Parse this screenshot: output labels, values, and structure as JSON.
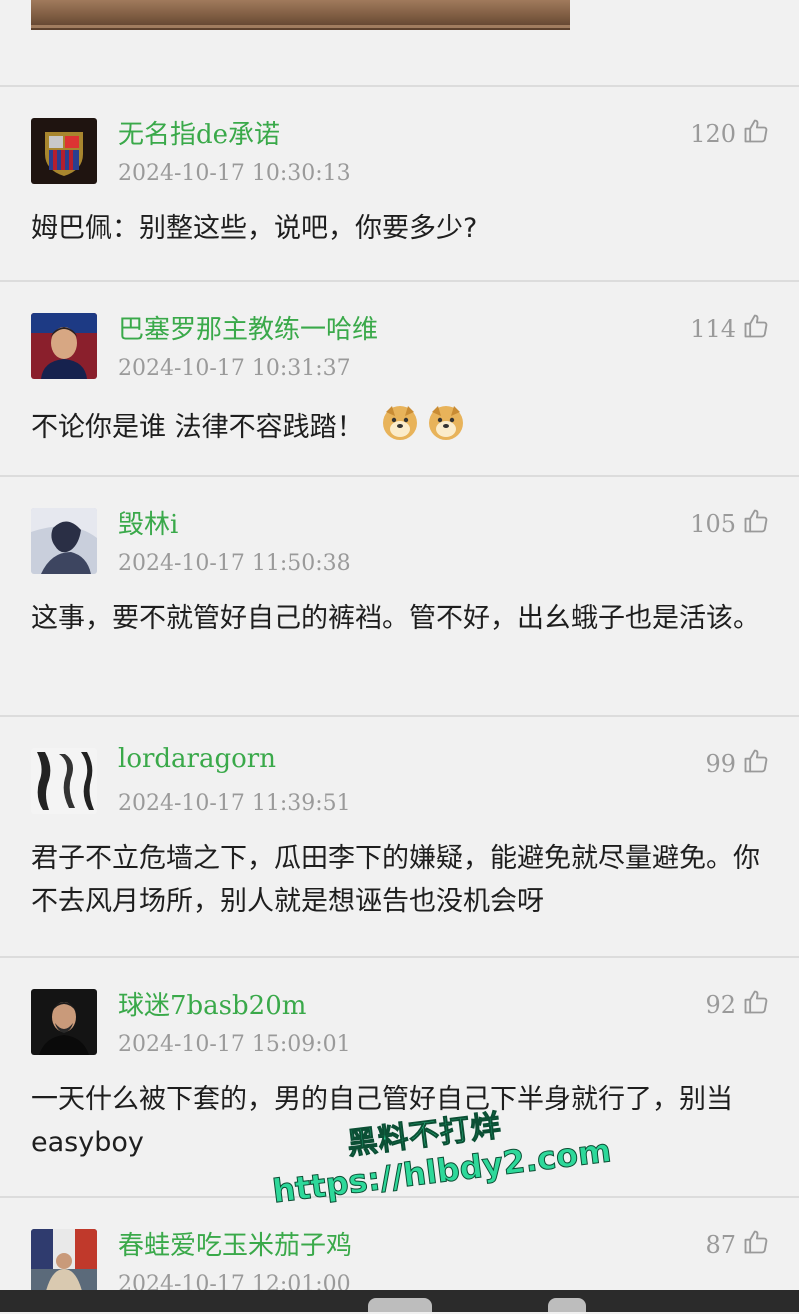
{
  "comments": [
    {
      "username": "无名指de承诺",
      "timestamp": "2024-10-17 10:30:13",
      "likes": "120",
      "text": "姆巴佩：别整这些，说吧，你要多少?"
    },
    {
      "username": "巴塞罗那主教练一哈维",
      "timestamp": "2024-10-17 10:31:37",
      "likes": "114",
      "text": "不论你是谁 法律不容践踏！"
    },
    {
      "username": "毁林i",
      "timestamp": "2024-10-17 11:50:38",
      "likes": "105",
      "text": "这事，要不就管好自己的裤裆。管不好，出幺蛾子也是活该。"
    },
    {
      "username": "lordaragorn",
      "timestamp": "2024-10-17 11:39:51",
      "likes": "99",
      "text": "君子不立危墙之下，瓜田李下的嫌疑，能避免就尽量避免。你不去风月场所，别人就是想诬告也没机会呀"
    },
    {
      "username": "球迷7basb20m",
      "timestamp": "2024-10-17 15:09:01",
      "likes": "92",
      "text": "一天什么被下套的，男的自己管好自己下半身就行了，别当easyboy"
    },
    {
      "username": "春蛙爱吃玉米茄子鸡",
      "timestamp": "2024-10-17 12:01:00",
      "likes": "87",
      "text": ""
    }
  ],
  "watermark": {
    "line1": "黑料不打烊",
    "line2": "https://hlbdy2.com"
  },
  "colors": {
    "username": "#3aa94a",
    "meta": "#9a9a9a",
    "divider": "#dcdcdc",
    "background": "#f1f1f1"
  },
  "icons": {
    "like": "thumbs-up-icon",
    "emoji": "doge-emoji-icon"
  }
}
